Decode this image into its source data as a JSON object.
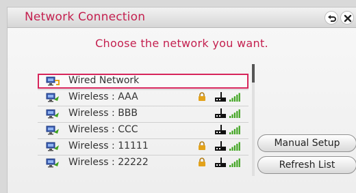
{
  "dialog": {
    "title": "Network Connection",
    "subtitle": "Choose the network you want."
  },
  "networks": [
    {
      "label": "Wired Network",
      "type": "wired",
      "secured": false,
      "selected": true,
      "signal_bars": 0
    },
    {
      "label": "Wireless : AAA",
      "type": "wireless",
      "secured": true,
      "selected": false,
      "signal_bars": 5
    },
    {
      "label": "Wireless : BBB",
      "type": "wireless",
      "secured": false,
      "selected": false,
      "signal_bars": 5
    },
    {
      "label": "Wireless : CCC",
      "type": "wireless",
      "secured": false,
      "selected": false,
      "signal_bars": 5
    },
    {
      "label": "Wireless : 11111",
      "type": "wireless",
      "secured": true,
      "selected": false,
      "signal_bars": 5
    },
    {
      "label": "Wireless : 22222",
      "type": "wireless",
      "secured": true,
      "selected": false,
      "signal_bars": 5
    }
  ],
  "buttons": {
    "manual_setup": "Manual Setup",
    "refresh_list": "Refresh List"
  },
  "icons": {
    "back": "back-icon",
    "close": "close-icon",
    "lock": "lock-icon",
    "antenna": "antenna-icon",
    "signal": "signal-strength-icon",
    "wired": "wired-network-icon",
    "wireless": "wireless-network-icon"
  },
  "colors": {
    "accent": "#c4204f",
    "selection": "#d6245a",
    "signal": "#3ea31e",
    "lock": "#e3a21a"
  }
}
